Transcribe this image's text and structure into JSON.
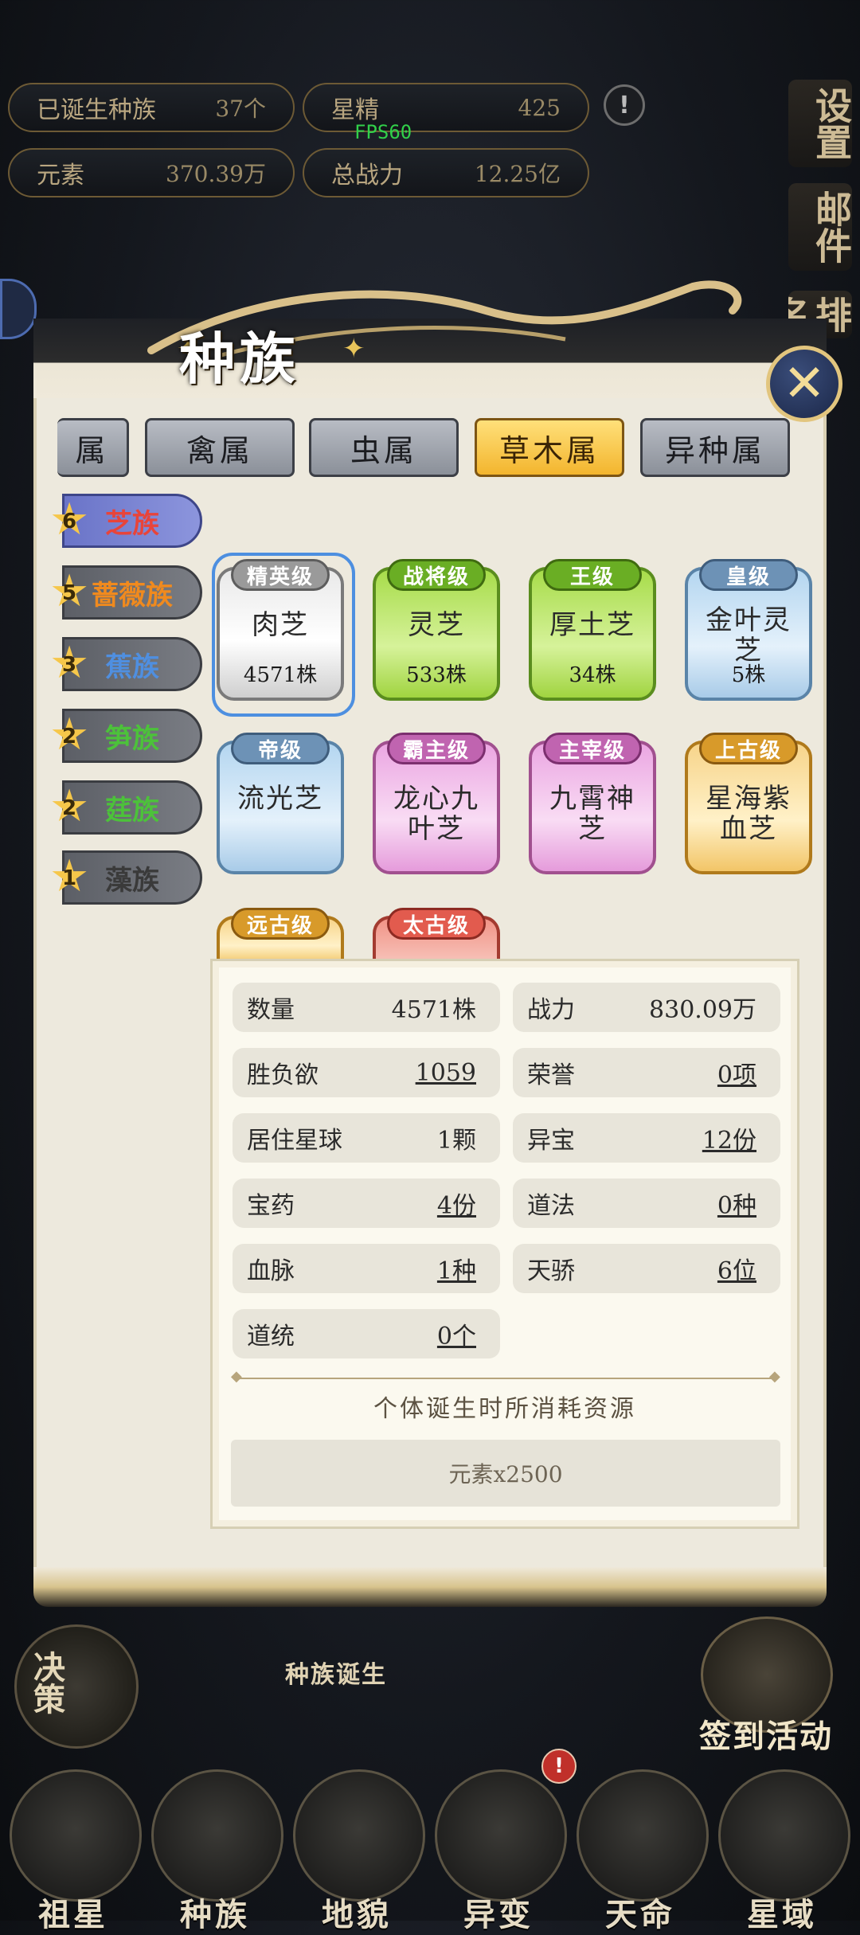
{
  "hud": {
    "born_species_label": "已诞生种族",
    "born_species_value": "37个",
    "star_essence_label": "星精",
    "star_essence_value": "425",
    "element_label": "元素",
    "element_value": "370.39万",
    "total_power_label": "总战力",
    "total_power_value": "12.25亿",
    "fps": "FPS60",
    "alert": "!"
  },
  "side_buttons": {
    "settings": "设置",
    "mail": "邮件",
    "rank": "排名"
  },
  "dialog": {
    "title": "种族",
    "close_glyph": "✕",
    "tabs": [
      "属",
      "禽属",
      "虫属",
      "草木属",
      "异种属"
    ],
    "sub_groups": [
      {
        "count": "6",
        "label": "芝族",
        "color": "#e8443a"
      },
      {
        "count": "5",
        "label": "蔷薇族",
        "color": "#f08a1e"
      },
      {
        "count": "3",
        "label": "蕉族",
        "color": "#4f8fe0"
      },
      {
        "count": "2",
        "label": "笋族",
        "color": "#4cc23a"
      },
      {
        "count": "2",
        "label": "莛族",
        "color": "#4cc23a"
      },
      {
        "count": "1",
        "label": "藻族",
        "color": "#3a3a3a"
      }
    ],
    "cards": [
      {
        "tier": "精英级",
        "name": "肉芝",
        "count": "4571株"
      },
      {
        "tier": "战将级",
        "name": "灵芝",
        "count": "533株"
      },
      {
        "tier": "王级",
        "name": "厚土芝",
        "count": "34株"
      },
      {
        "tier": "皇级",
        "name": "金叶灵芝",
        "count": "5株"
      },
      {
        "tier": "帝级",
        "name": "流光芝",
        "count": ""
      },
      {
        "tier": "霸主级",
        "name": "龙心九叶芝",
        "count": ""
      },
      {
        "tier": "主宰级",
        "name": "九霄神芝",
        "count": ""
      },
      {
        "tier": "上古级",
        "name": "星海紫血芝",
        "count": ""
      },
      {
        "tier": "远古级",
        "name": "",
        "count": ""
      },
      {
        "tier": "太古级",
        "name": "",
        "count": ""
      }
    ],
    "stats": {
      "quantity_label": "数量",
      "quantity_value": "4571株",
      "power_label": "战力",
      "power_value": "830.09万",
      "desire_label": "胜负欲",
      "desire_value": "1059",
      "honor_label": "荣誉",
      "honor_value": "0项",
      "planet_label": "居住星球",
      "planet_value": "1颗",
      "treasure_label": "异宝",
      "treasure_value": "12份",
      "medicine_label": "宝药",
      "medicine_value": "4份",
      "dao_label": "道法",
      "dao_value": "0种",
      "bloodline_label": "血脉",
      "bloodline_value": "1种",
      "prodigy_label": "天骄",
      "prodigy_value": "6位",
      "lineage_label": "道统",
      "lineage_value": "0个"
    },
    "cost_title": "个体诞生时所消耗资源",
    "cost_value": "元素x2500"
  },
  "bottom": {
    "species_birth": "种族诞生",
    "decision": "决策",
    "checkin": "签到活动",
    "nav": [
      "祖星",
      "种族",
      "地貌",
      "异变",
      "天命",
      "星域"
    ],
    "nav_alert": "!"
  }
}
